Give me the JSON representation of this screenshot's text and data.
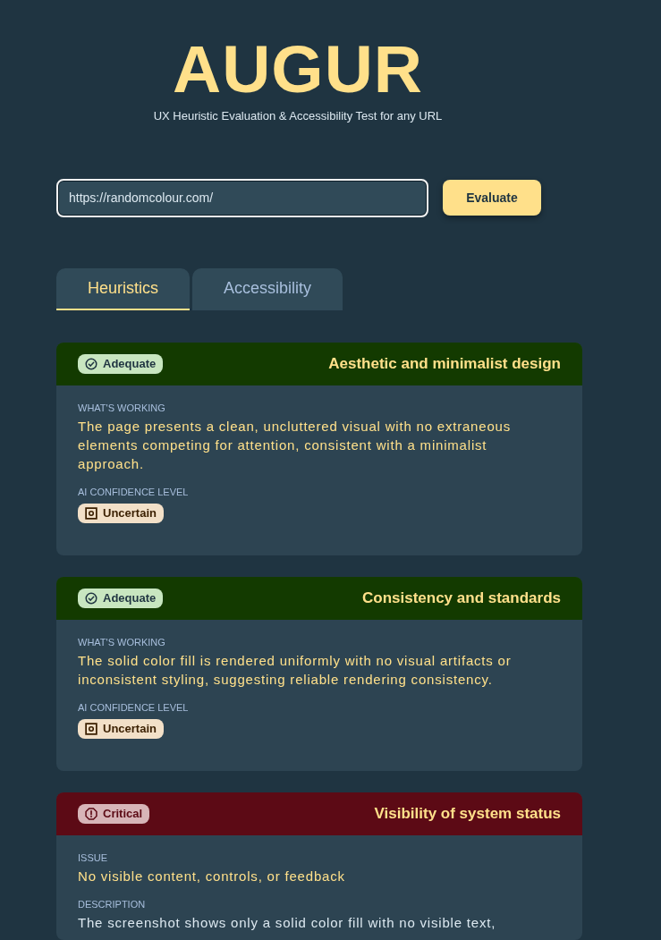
{
  "app": {
    "title": "AUGUR",
    "subtitle": "UX Heuristic Evaluation & Accessibility Test for any URL"
  },
  "url_form": {
    "value": "https://randomcolour.com/",
    "button": "Evaluate"
  },
  "tabs": [
    {
      "label": "Heuristics",
      "selected": true
    },
    {
      "label": "Accessibility",
      "selected": false
    }
  ],
  "cards": [
    {
      "status": {
        "kind": "adequate",
        "label": "Adequate"
      },
      "title": "Aesthetic and minimalist design",
      "sections": [
        {
          "kind": "highlight",
          "label": "WHAT'S WORKING",
          "text": "The page presents a clean, uncluttered visual with no extraneous elements competing for attention, consistent with a minimalist approach."
        },
        {
          "kind": "confidence",
          "label": "AI CONFIDENCE LEVEL",
          "text": "Uncertain"
        }
      ]
    },
    {
      "status": {
        "kind": "adequate",
        "label": "Adequate"
      },
      "title": "Consistency and standards",
      "sections": [
        {
          "kind": "highlight",
          "label": "WHAT'S WORKING",
          "text": "The solid color fill is rendered uniformly with no visual artifacts or inconsistent styling, suggesting reliable rendering consistency."
        },
        {
          "kind": "confidence",
          "label": "AI CONFIDENCE LEVEL",
          "text": "Uncertain"
        }
      ]
    },
    {
      "status": {
        "kind": "critical",
        "label": "Critical"
      },
      "title": "Visibility of system status",
      "sections": [
        {
          "kind": "highlight",
          "label": "ISSUE",
          "text": "No visible content, controls, or feedback"
        },
        {
          "kind": "plain",
          "label": "DESCRIPTION",
          "text": "The screenshot shows only a solid color fill with no visible text,"
        }
      ]
    }
  ]
}
